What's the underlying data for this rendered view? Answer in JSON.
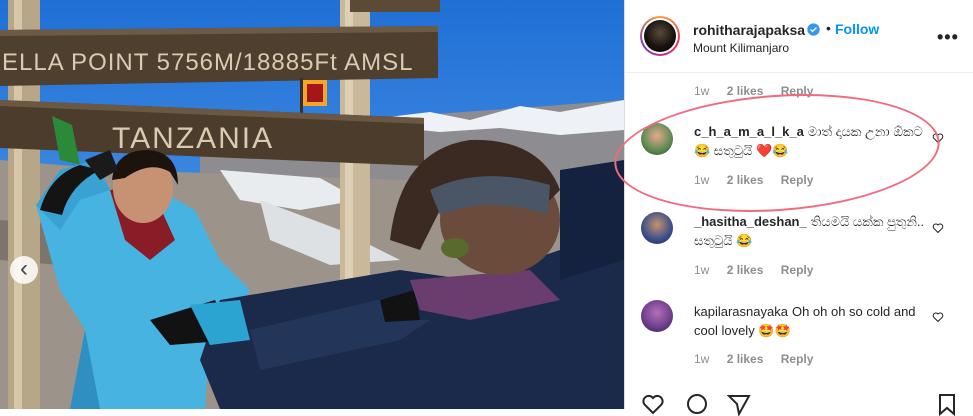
{
  "post": {
    "username": "rohitharajapaksa",
    "follow_label": "Follow",
    "dot": "•",
    "location": "Mount Kilimanjaro",
    "more_label": "•••"
  },
  "photo": {
    "sign_top": "ELLA POINT 5756M/18885Ft AMSL",
    "sign_mid": "TANZANIA",
    "carousel_prev": "‹"
  },
  "comments": [
    {
      "time": "1w",
      "likes": "2 likes",
      "reply": "Reply"
    },
    {
      "username": "c_h_a_m_a_l_k_a",
      "text": "මාත් දායක උනා ඕකට 😂 සතුටුයි ❤️😂",
      "time": "1w",
      "likes": "2 likes",
      "reply": "Reply"
    },
    {
      "username": "_hasitha_deshan_",
      "text": "තියමයි යක්ක පුතුනි.. සතුටුයි 😂",
      "time": "1w",
      "likes": "2 likes",
      "reply": "Reply"
    },
    {
      "username": "kapilarasnayaka",
      "text": "Oh oh oh so cold and cool lovely 🤩🤩",
      "time": "1w",
      "likes": "2 likes",
      "reply": "Reply"
    }
  ],
  "colors": {
    "accent": "#0095f6",
    "highlight": "#ef6b7e"
  }
}
